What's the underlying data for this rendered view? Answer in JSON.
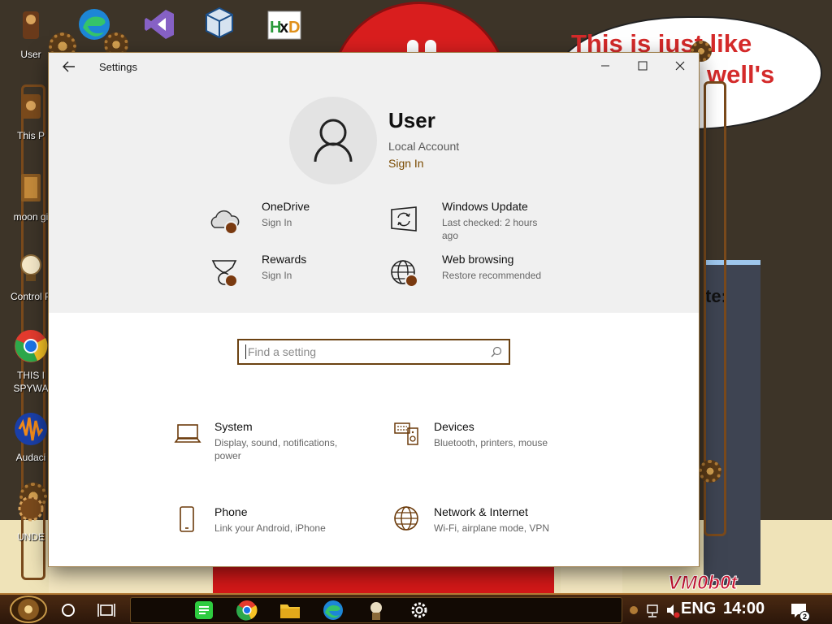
{
  "desktop": {
    "icons": [
      {
        "label": "User"
      },
      {
        "label": ""
      },
      {
        "label": ""
      },
      {
        "label": ""
      },
      {
        "label": ""
      },
      {
        "label": "This P"
      },
      {
        "label": "moon gi"
      },
      {
        "label": "Control P"
      },
      {
        "label": "THIS I SPYWA"
      },
      {
        "label": "Audaci"
      },
      {
        "label": "UNDE"
      }
    ],
    "bubble_lines": [
      "This is just like",
      "well's"
    ],
    "panel_text": "te:",
    "watermark": "VM0b0t"
  },
  "window": {
    "title": "Settings",
    "back_icon": "arrow-left-icon",
    "controls": [
      "minimize-icon",
      "maximize-icon",
      "close-icon"
    ]
  },
  "account": {
    "name": "User",
    "type": "Local Account",
    "sign_in": "Sign In"
  },
  "quick": [
    {
      "title": "OneDrive",
      "sub": "Sign In",
      "icon": "cloud-icon"
    },
    {
      "title": "Windows Update",
      "sub": "Last checked: 2 hours ago",
      "icon": "update-icon"
    },
    {
      "title": "Rewards",
      "sub": "Sign In",
      "icon": "medal-icon"
    },
    {
      "title": "Web browsing",
      "sub": "Restore recommended",
      "icon": "globe-icon"
    }
  ],
  "search": {
    "placeholder": "Find a setting",
    "icon": "search-icon"
  },
  "categories": [
    {
      "title": "System",
      "sub": "Display, sound, notifications, power",
      "icon": "laptop-icon"
    },
    {
      "title": "Devices",
      "sub": "Bluetooth, printers, mouse",
      "icon": "keyboard-speaker-icon"
    },
    {
      "title": "Phone",
      "sub": "Link your Android, iPhone",
      "icon": "phone-icon"
    },
    {
      "title": "Network & Internet",
      "sub": "Wi-Fi, airplane mode, VPN",
      "icon": "globe-icon"
    }
  ],
  "taskbar": {
    "pinned": [
      "spotify-icon",
      "chrome-icon",
      "folder-icon",
      "edge-icon",
      "app-icon",
      "settings-icon"
    ],
    "lang": "ENG",
    "time": "14:00",
    "notifications": "2"
  },
  "colors": {
    "accent": "#7a4a00",
    "dot": "#7a3a10",
    "header_bg": "#f0f0f0"
  }
}
